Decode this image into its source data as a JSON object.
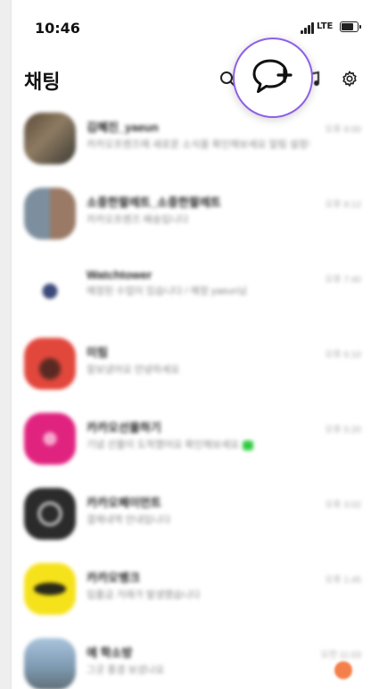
{
  "status_bar": {
    "time": "10:46",
    "network": "LTE"
  },
  "header": {
    "title": "채팅"
  },
  "colors": {
    "accent": "#8f5fe6",
    "badge": "#f57f4b"
  },
  "chats": [
    {
      "name": "김혜진_yaeun",
      "preview": "카카오프렌즈에 새로운 소식을 확인해보세요 알림 설정하고 빠르게 받아보세요",
      "time": "오후 9:00"
    },
    {
      "name": "소중한팔레트_소중한팔레트",
      "preview": "카카오프렌즈 배송입니다",
      "time": "오후 8:12"
    },
    {
      "name": "Watchtower",
      "preview": "예정된 수업이 있습니다 / 예정 yaeun님",
      "time": "오후 7:40"
    },
    {
      "name": "미림",
      "preview": "잘보냈어요 안녕하세요",
      "time": "오후 6:10"
    },
    {
      "name": "카카오선물하기",
      "preview": "기념 선물이 도착했어요 확인해보세요",
      "time": "오후 5:20"
    },
    {
      "name": "카카오페이먼트",
      "preview": "결제내역 안내입니다",
      "time": "오후 3:02"
    },
    {
      "name": "카카오뱅크",
      "preview": "입출금 거래가 발생했습니다",
      "time": "오후 1:45"
    },
    {
      "name": "에 학소방",
      "preview": "그곳 풍경 보셨나요",
      "time": "오전 11:03"
    }
  ]
}
